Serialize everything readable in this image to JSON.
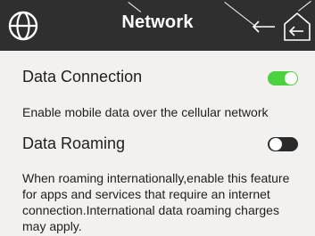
{
  "header": {
    "title": "Network",
    "icons": {
      "left": "globe-icon",
      "back": "back-arrow-icon",
      "home": "home-icon"
    }
  },
  "settings": [
    {
      "label": "Data Connection",
      "description": "Enable mobile data over the cellular network",
      "enabled": true
    },
    {
      "label": "Data Roaming",
      "description": "When roaming internationally,enable this feature for apps and services that require an internet connection.International data roaming charges may apply.",
      "enabled": false
    }
  ],
  "colors": {
    "header_bg": "#2f2f2f",
    "page_bg": "#f2f1ef",
    "toggle_on": "#4cd23f",
    "toggle_off": "#2a2a2a"
  }
}
